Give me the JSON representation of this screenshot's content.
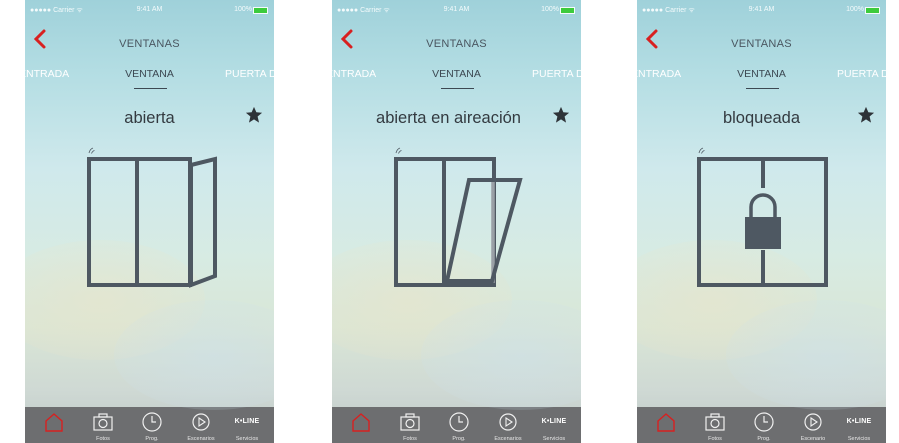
{
  "screens": [
    {
      "status": {
        "carrier": "●●●●● Carrier ᯤ",
        "time": "9:41 AM",
        "battery": "100%"
      },
      "nav": {
        "title": "VENTANAS"
      },
      "tabs": [
        "ENTRADA",
        "VENTANA",
        "PUERTA DE"
      ],
      "state_label": "abierta",
      "window_state": "open",
      "tabbar": [
        "",
        "Fotos",
        "Prog.",
        "Escenarios",
        "Servicios"
      ],
      "brand": "K•LINE"
    },
    {
      "status": {
        "carrier": "●●●●● Carrier ᯤ",
        "time": "9:41 AM",
        "battery": "100%"
      },
      "nav": {
        "title": "VENTANAS"
      },
      "tabs": [
        "ENTRADA",
        "VENTANA",
        "PUERTA DE"
      ],
      "state_label": "abierta en aireación",
      "window_state": "tilted",
      "tabbar": [
        "",
        "Fotos",
        "Prog.",
        "Escenarios",
        "Servicios"
      ],
      "brand": "K•LINE"
    },
    {
      "status": {
        "carrier": "●●●●● Carrier ᯤ",
        "time": "9:41 AM",
        "battery": "100%"
      },
      "nav": {
        "title": "VENTANAS"
      },
      "tabs": [
        "ENTRADA",
        "VENTANA",
        "PUERTA DE"
      ],
      "state_label": "bloqueada",
      "window_state": "locked",
      "tabbar": [
        "",
        "Fotos",
        "Prog.",
        "Escenario",
        "Servicios"
      ],
      "brand": "K•LINE"
    }
  ],
  "colors": {
    "accent": "#d82020",
    "icon": "#4e5862",
    "tabbar": "#6d6e70"
  }
}
